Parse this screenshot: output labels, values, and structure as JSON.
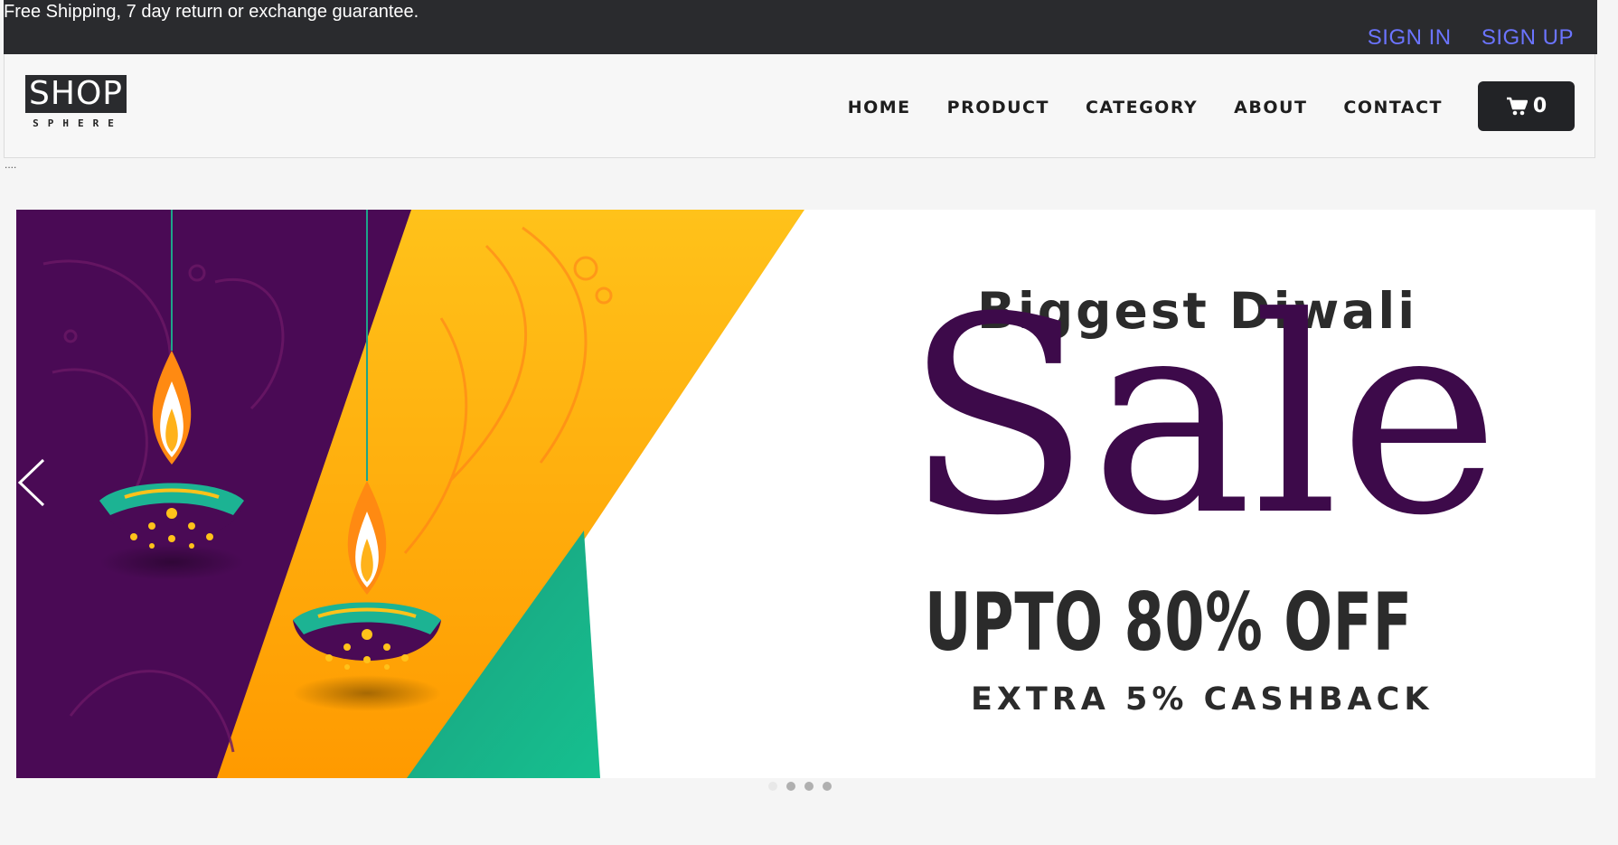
{
  "topbar": {
    "promo": "Free Shipping, 7 day return or exchange guarantee.",
    "sign_in": "SIGN IN",
    "sign_up": "SIGN UP",
    "auth_color": "#6b74ff"
  },
  "brand": {
    "name": "SHOP",
    "tagline": "SPHERE"
  },
  "nav": {
    "items": [
      "HOME",
      "PRODUCT",
      "CATEGORY",
      "ABOUT",
      "CONTACT"
    ]
  },
  "cart": {
    "icon": "cart-icon",
    "count": "0"
  },
  "misc": {
    "dots": "...."
  },
  "banner": {
    "headline": "Biggest Diwali",
    "sale": "Sale",
    "discount": "UPTO 80% OFF",
    "cashback": "EXTRA 5% CASHBACK",
    "colors": {
      "purple": "#3d0a4a",
      "orange": "#ffa500",
      "teal": "#18b38d"
    }
  },
  "carousel": {
    "slides": 4,
    "active_index": 0,
    "prev_icon": "chevron-left-icon"
  }
}
